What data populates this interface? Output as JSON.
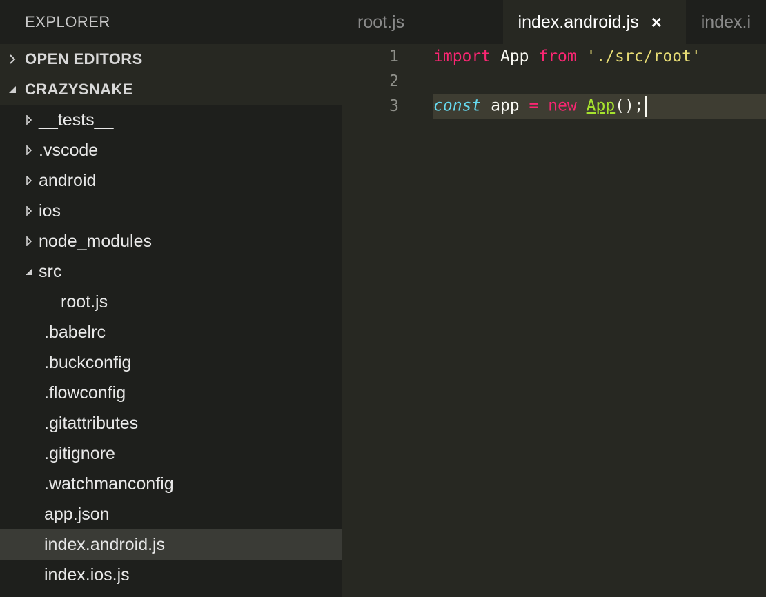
{
  "explorer": {
    "title": "EXPLORER",
    "sections": {
      "open_editors": "OPEN EDITORS",
      "project": "CRAZYSNAKE"
    },
    "tree": [
      {
        "label": "__tests__",
        "type": "folder",
        "expanded": false
      },
      {
        "label": ".vscode",
        "type": "folder",
        "expanded": false
      },
      {
        "label": "android",
        "type": "folder",
        "expanded": false
      },
      {
        "label": "ios",
        "type": "folder",
        "expanded": false
      },
      {
        "label": "node_modules",
        "type": "folder",
        "expanded": false
      },
      {
        "label": "src",
        "type": "folder",
        "expanded": true
      },
      {
        "label": "root.js",
        "type": "file",
        "depth": 2
      },
      {
        "label": ".babelrc",
        "type": "file"
      },
      {
        "label": ".buckconfig",
        "type": "file"
      },
      {
        "label": ".flowconfig",
        "type": "file"
      },
      {
        "label": ".gitattributes",
        "type": "file"
      },
      {
        "label": ".gitignore",
        "type": "file"
      },
      {
        "label": ".watchmanconfig",
        "type": "file"
      },
      {
        "label": "app.json",
        "type": "file"
      },
      {
        "label": "index.android.js",
        "type": "file",
        "selected": true
      },
      {
        "label": "index.ios.js",
        "type": "file"
      }
    ]
  },
  "tabs": [
    {
      "label": "root.js",
      "active": false
    },
    {
      "label": "index.android.js",
      "active": true,
      "close_icon": "×"
    },
    {
      "label": "index.i",
      "active": false
    }
  ],
  "code": {
    "line_numbers": [
      "1",
      "2",
      "3"
    ],
    "line1": {
      "kw1": "import",
      "id": " App ",
      "kw2": "from",
      "sp": " ",
      "str": "'./src/root'"
    },
    "line3": {
      "storage": "const",
      "id": " app ",
      "op": "=",
      "sp": " ",
      "kw": "new",
      "sp2": " ",
      "cls": "App",
      "tail": "();"
    }
  },
  "colors": {
    "background": "#272822",
    "sidebar": "#1e1f1c",
    "keyword": "#f92672",
    "string": "#e6db74",
    "storage": "#66d9ef",
    "class": "#a6e22e"
  }
}
